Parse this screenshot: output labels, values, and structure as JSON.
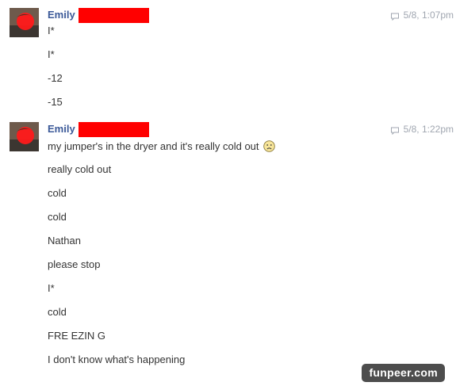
{
  "messages": [
    {
      "sender": "Emily",
      "time": "5/8, 1:07pm",
      "lines": [
        "I*",
        "I*",
        "-12",
        "-15"
      ]
    },
    {
      "sender": "Emily",
      "time": "5/8, 1:22pm",
      "lines": [
        "my jumper's in the dryer and it's really cold out",
        "really cold out",
        "cold",
        "cold",
        "Nathan",
        "please stop",
        "I*",
        "cold",
        "FRE EZIN G",
        "I don't know what's happening"
      ]
    }
  ],
  "icons": {
    "timestamp": "chat-bubble-icon",
    "first_line_emoji": "frown-emoji-icon"
  },
  "colors": {
    "sender_name": "#3b5998",
    "redaction": "#ff0000",
    "timestamp": "#a0a6b0",
    "watermark_bg": "#4d4d4d"
  },
  "watermark": "funpeer.com"
}
